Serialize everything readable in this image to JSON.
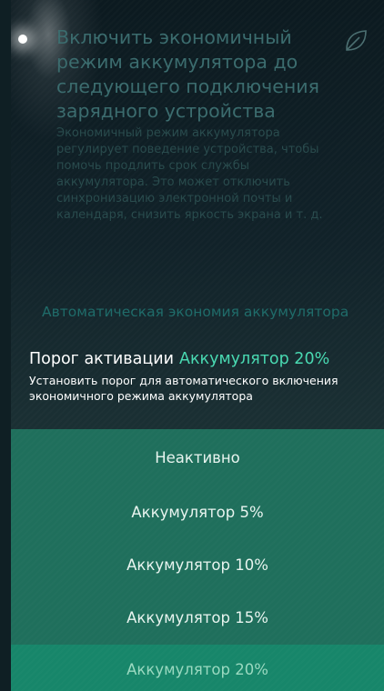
{
  "eco_toggle": {
    "title": "Включить экономичный режим аккумулятора до следующего подключения зарядного устройства",
    "description": "Экономичный режим аккумулятора регулирует поведение устройства, чтобы помочь продлить срок службы аккумулятора. Это может отключить синхронизацию электронной почты и календаря, снизить яркость экрана и т. д.",
    "icon": "leaf-icon"
  },
  "section_header": "Автоматическая экономия аккумулятора",
  "threshold": {
    "label": "Порог активации",
    "value": "Аккумулятор 20%",
    "description": "Установить порог для автоматического включения экономичного режима аккумулятора"
  },
  "menu": {
    "items": [
      {
        "label": "Неактивно"
      },
      {
        "label": "Аккумулятор 5%"
      },
      {
        "label": "Аккумулятор 10%"
      },
      {
        "label": "Аккумулятор 15%"
      },
      {
        "label": "Аккумулятор 20%"
      }
    ],
    "selected_index": 4
  },
  "colors": {
    "accent": "#48d9b1",
    "menu_background": "#1f6f5c",
    "menu_selected": "#17866a"
  }
}
